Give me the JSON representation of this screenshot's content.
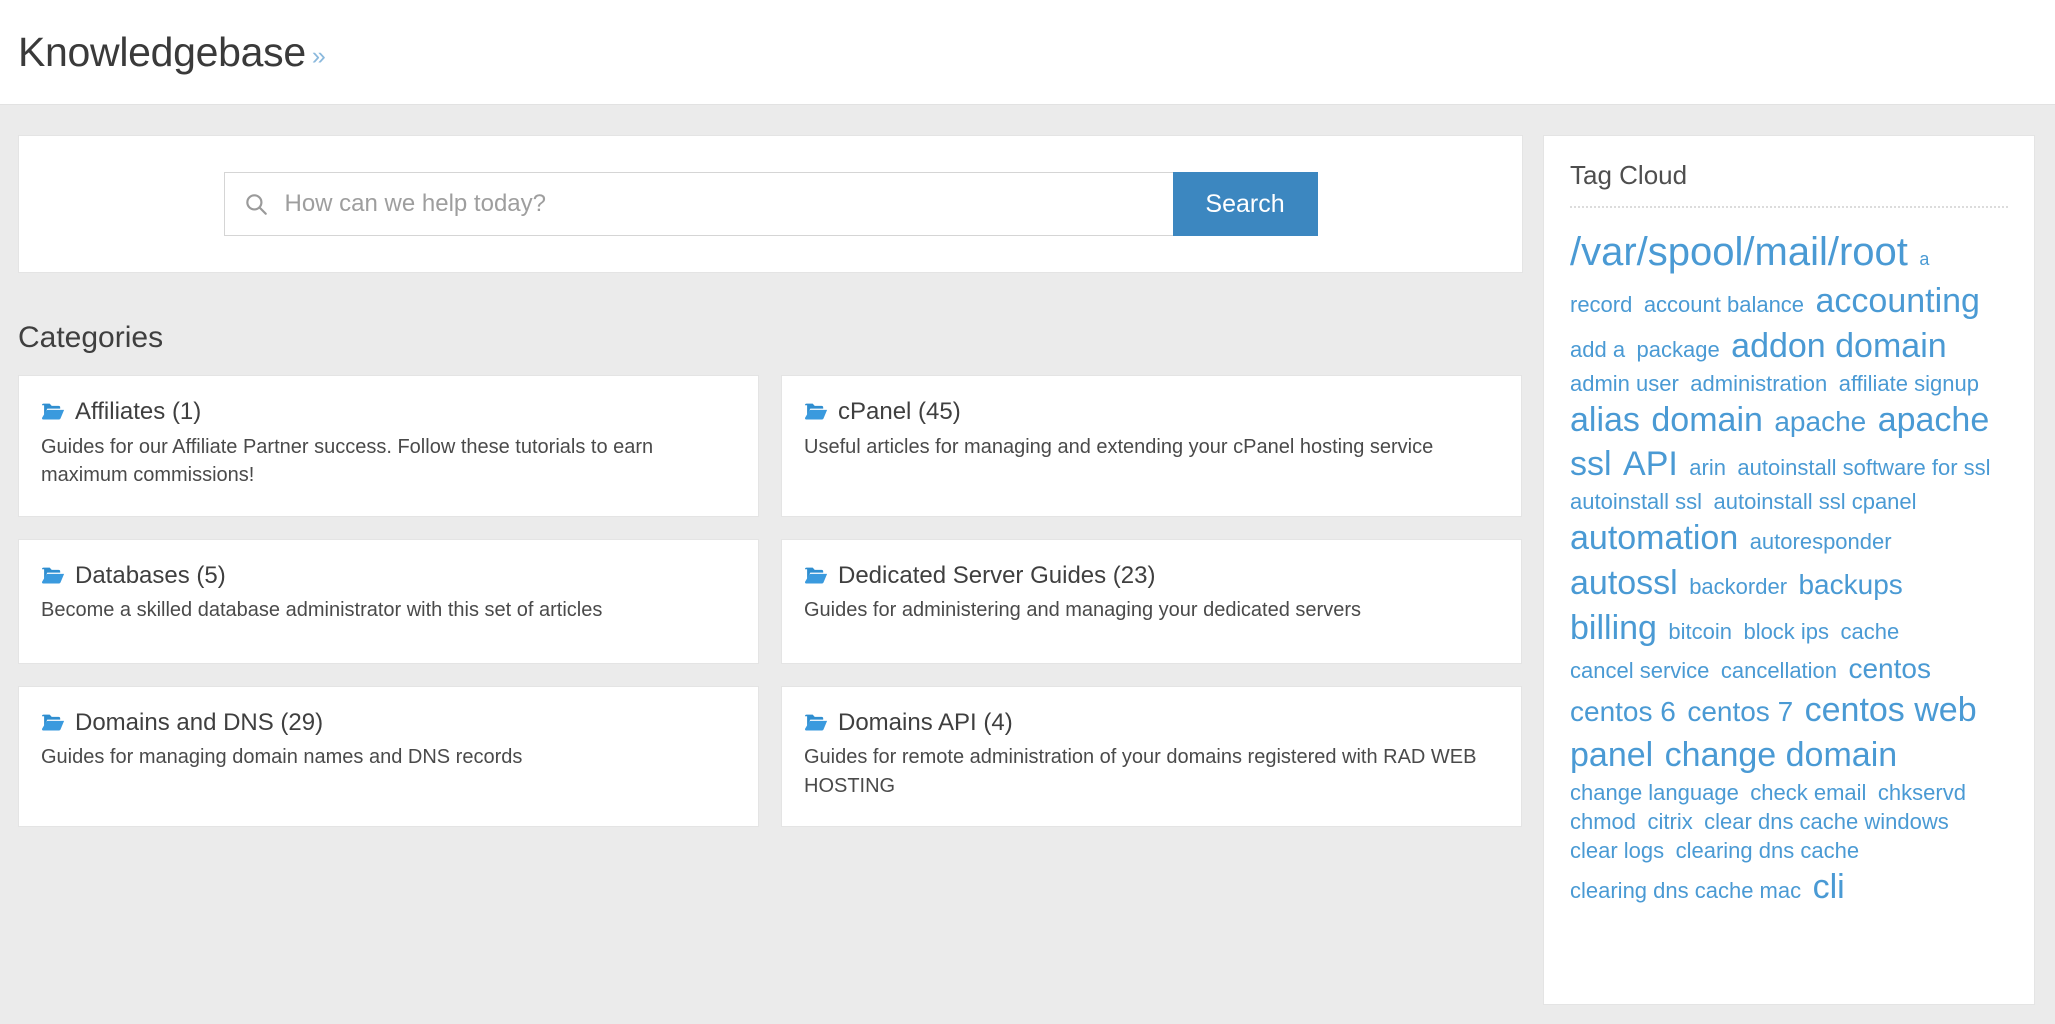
{
  "header": {
    "title": "Knowledgebase",
    "breadcrumb_separator": "»"
  },
  "search": {
    "placeholder": "How can we help today?",
    "value": "",
    "button_label": "Search",
    "icon": "search-icon"
  },
  "categories": {
    "heading": "Categories",
    "folder_icon": "folder-open-icon",
    "items": [
      {
        "title": "Affiliates (1)",
        "name": "Affiliates",
        "count": 1,
        "description": "Guides for our Affiliate Partner success. Follow these tutorials to earn maximum commissions!"
      },
      {
        "title": "cPanel (45)",
        "name": "cPanel",
        "count": 45,
        "description": "Useful articles for managing and extending your cPanel hosting service"
      },
      {
        "title": "Databases (5)",
        "name": "Databases",
        "count": 5,
        "description": "Become a skilled database administrator with this set of articles"
      },
      {
        "title": "Dedicated Server Guides (23)",
        "name": "Dedicated Server Guides",
        "count": 23,
        "description": "Guides for administering and managing your dedicated servers"
      },
      {
        "title": "Domains and DNS (29)",
        "name": "Domains and DNS",
        "count": 29,
        "description": "Guides for managing domain names and DNS records"
      },
      {
        "title": "Domains API (4)",
        "name": "Domains API",
        "count": 4,
        "description": "Guides for remote administration of your domains registered with RAD WEB HOSTING"
      }
    ]
  },
  "tag_cloud": {
    "title": "Tag Cloud",
    "link_color": "#4a9ad4",
    "tags": [
      {
        "label": "/var/spool/mail/root",
        "size": 5
      },
      {
        "label": "a",
        "size": 1
      },
      {
        "label": "record",
        "size": 2
      },
      {
        "label": "account balance",
        "size": 2
      },
      {
        "label": "accounting",
        "size": 4
      },
      {
        "label": "add a",
        "size": 2
      },
      {
        "label": "package",
        "size": 2
      },
      {
        "label": "addon domain",
        "size": 4
      },
      {
        "label": "admin user",
        "size": 2
      },
      {
        "label": "administration",
        "size": 2
      },
      {
        "label": "affiliate signup",
        "size": 2
      },
      {
        "label": "alias",
        "size": 4
      },
      {
        "label": "domain",
        "size": 4
      },
      {
        "label": "apache",
        "size": 3
      },
      {
        "label": "apache",
        "size": 4
      },
      {
        "label": "ssl",
        "size": 4
      },
      {
        "label": "API",
        "size": 4
      },
      {
        "label": "arin",
        "size": 2
      },
      {
        "label": "autoinstall software for ssl",
        "size": 2
      },
      {
        "label": "autoinstall ssl",
        "size": 2
      },
      {
        "label": "autoinstall ssl cpanel",
        "size": 2
      },
      {
        "label": "automation",
        "size": 4
      },
      {
        "label": "autoresponder",
        "size": 2
      },
      {
        "label": "autossl",
        "size": 4
      },
      {
        "label": "backorder",
        "size": 2
      },
      {
        "label": "backups",
        "size": 3
      },
      {
        "label": "billing",
        "size": 4
      },
      {
        "label": "bitcoin",
        "size": 2
      },
      {
        "label": "block ips",
        "size": 2
      },
      {
        "label": "cache",
        "size": 2
      },
      {
        "label": "cancel service",
        "size": 2
      },
      {
        "label": "cancellation",
        "size": 2
      },
      {
        "label": "centos",
        "size": 3
      },
      {
        "label": "centos 6",
        "size": 3
      },
      {
        "label": "centos 7",
        "size": 3
      },
      {
        "label": "centos web",
        "size": 4
      },
      {
        "label": "panel",
        "size": 4
      },
      {
        "label": "change domain",
        "size": 4
      },
      {
        "label": "change language",
        "size": 2
      },
      {
        "label": "check email",
        "size": 2
      },
      {
        "label": "chkservd",
        "size": 2
      },
      {
        "label": "chmod",
        "size": 2
      },
      {
        "label": "citrix",
        "size": 2
      },
      {
        "label": "clear dns cache windows",
        "size": 2
      },
      {
        "label": "clear logs",
        "size": 2
      },
      {
        "label": "clearing dns cache",
        "size": 2
      },
      {
        "label": "clearing dns cache mac",
        "size": 2
      },
      {
        "label": "cli",
        "size": 4
      }
    ]
  }
}
